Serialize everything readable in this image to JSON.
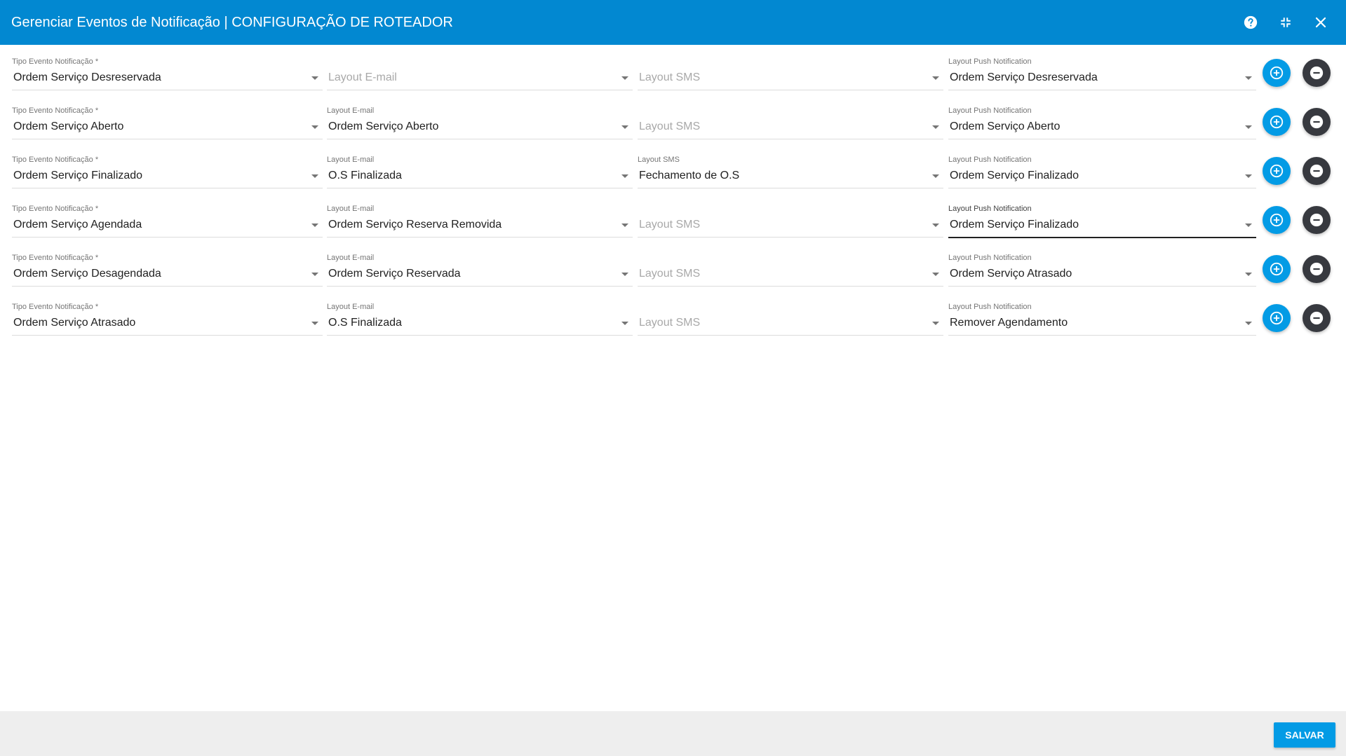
{
  "header": {
    "title": "Gerenciar Eventos de Notificação | CONFIGURAÇÃO DE ROTEADOR",
    "icons": [
      "help-icon",
      "fullscreen-exit-icon",
      "close-icon"
    ],
    "color": "#0288d1"
  },
  "labels": {
    "event_type": "Tipo Evento Notificação *",
    "email": "Layout E-mail",
    "sms": "Layout SMS",
    "push": "Layout Push Notification"
  },
  "rows": [
    {
      "event_type": "Ordem Serviço Desreservada",
      "email": "",
      "sms": "",
      "push": "Ordem Serviço Desreservada"
    },
    {
      "event_type": "Ordem Serviço Aberto",
      "email": "Ordem Serviço Aberto",
      "sms": "",
      "push": "Ordem Serviço Aberto"
    },
    {
      "event_type": "Ordem Serviço Finalizado",
      "email": "O.S Finalizada",
      "sms": "Fechamento de O.S",
      "push": "Ordem Serviço Finalizado"
    },
    {
      "event_type": "Ordem Serviço Agendada",
      "email": "Ordem Serviço Reserva Removida",
      "sms": "",
      "push": "Ordem Serviço Finalizado"
    },
    {
      "event_type": "Ordem Serviço Desagendada",
      "email": "Ordem Serviço Reservada",
      "sms": "",
      "push": "Ordem Serviço Atrasado"
    },
    {
      "event_type": "Ordem Serviço Atrasado",
      "email": "O.S Finalizada",
      "sms": "",
      "push": "Remover Agendamento"
    }
  ],
  "focused_field": {
    "row": 3,
    "column": "push"
  },
  "footer": {
    "save_label": "SALVAR"
  },
  "colors": {
    "accent": "#039be5",
    "remove_button": "#37393f",
    "footer_background": "#eeeeee"
  }
}
